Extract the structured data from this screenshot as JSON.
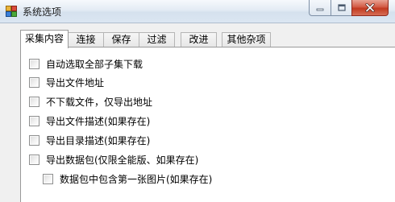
{
  "window": {
    "title": "系统选项"
  },
  "tabs": [
    {
      "label": "采集内容",
      "active": true
    },
    {
      "label": "连接",
      "active": false
    },
    {
      "label": "保存",
      "active": false
    },
    {
      "label": "过滤",
      "active": false
    },
    {
      "label": "改进",
      "active": false
    },
    {
      "label": "其他杂项",
      "active": false
    }
  ],
  "options": [
    {
      "label": "自动选取全部子集下载",
      "checked": false
    },
    {
      "label": "导出文件地址",
      "checked": false
    },
    {
      "label": "不下载文件，仅导出地址",
      "checked": false
    },
    {
      "label": "导出文件描述(如果存在)",
      "checked": false
    },
    {
      "label": "导出目录描述(如果存在)",
      "checked": false
    },
    {
      "label": "导出数据包(仅限全能版、如果存在)",
      "checked": false
    },
    {
      "label": "数据包中包含第一张图片(如果存在)",
      "checked": false
    }
  ],
  "icons": {
    "app": "app-icon",
    "minimize": "minimize-icon",
    "maximize": "maximize-icon",
    "close": "close-icon"
  },
  "colors": {
    "close_button": "#c2391f",
    "titlebar": "#dbe6f2"
  }
}
